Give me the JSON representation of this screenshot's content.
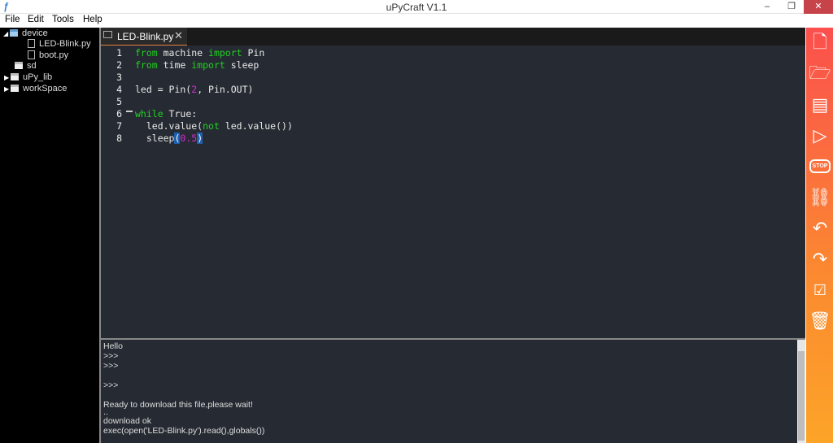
{
  "window": {
    "title": "uPyCraft V1.1",
    "app_icon": "upycraft-logo"
  },
  "menu": [
    "File",
    "Edit",
    "Tools",
    "Help"
  ],
  "tree": [
    {
      "label": "device",
      "depth": 0,
      "type": "folder",
      "expanded": true
    },
    {
      "label": "LED-Blink.py",
      "depth": 1,
      "type": "file"
    },
    {
      "label": "boot.py",
      "depth": 1,
      "type": "file"
    },
    {
      "label": "sd",
      "depth": 0,
      "type": "folder"
    },
    {
      "label": "uPy_lib",
      "depth": 0,
      "type": "folder",
      "collapsed": true
    },
    {
      "label": "workSpace",
      "depth": 0,
      "type": "folder",
      "collapsed": true
    }
  ],
  "tab": {
    "label": "LED-Blink.py"
  },
  "code": {
    "line_numbers": [
      "1",
      "2",
      "3",
      "4",
      "5",
      "6",
      "7",
      "8"
    ]
  },
  "console": [
    "Hello",
    ">>>",
    ">>>",
    "",
    ">>>",
    "",
    "Ready to download this file,please wait!",
    "..",
    "download ok",
    "exec(open('LED-Blink.py').read(),globals())"
  ],
  "toolbar": [
    "new-file",
    "open-file",
    "save",
    "run",
    "stop",
    "connect",
    "undo",
    "redo",
    "syntax-check",
    "clear"
  ],
  "colors": {
    "keyword": "#22d022",
    "number": "#d52ad5",
    "toolbar_top": "#fb4f4d",
    "toolbar_bottom": "#fca428"
  }
}
